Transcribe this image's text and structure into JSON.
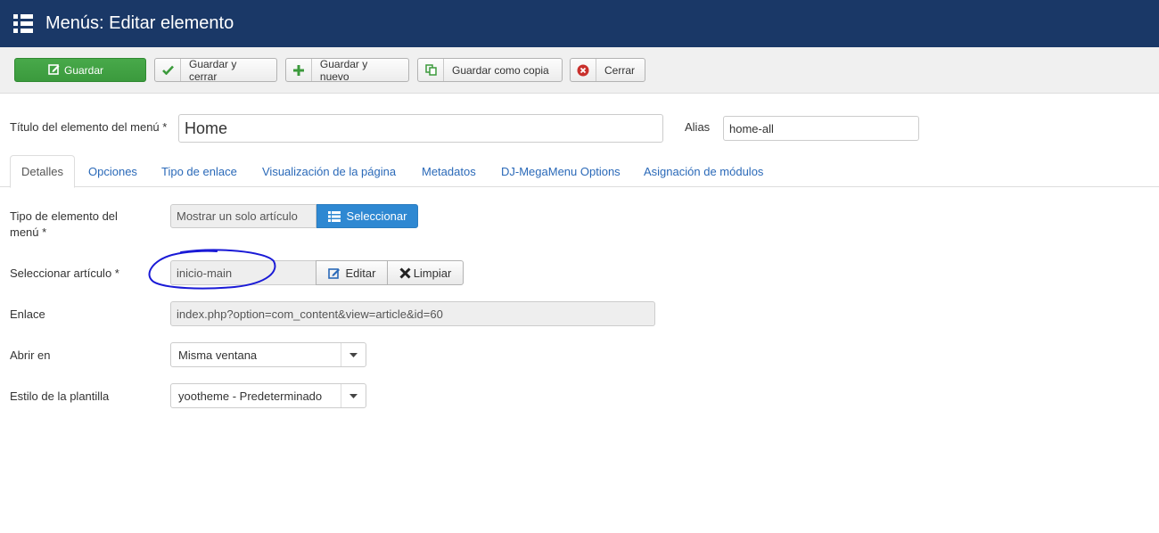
{
  "header": {
    "title": "Menús: Editar elemento",
    "icon": "list-icon"
  },
  "toolbar": {
    "save": "Guardar",
    "save_close": "Guardar y cerrar",
    "save_new": "Guardar y nuevo",
    "save_copy": "Guardar como copia",
    "close": "Cerrar"
  },
  "form": {
    "title_label": "Título del elemento del menú *",
    "title_value": "Home",
    "alias_label": "Alias",
    "alias_value": "home-all"
  },
  "tabs": [
    {
      "label": "Detalles",
      "active": true
    },
    {
      "label": "Opciones"
    },
    {
      "label": "Tipo de enlace"
    },
    {
      "label": "Visualización de la página"
    },
    {
      "label": "Metadatos"
    },
    {
      "label": "DJ-MegaMenu Options"
    },
    {
      "label": "Asignación de módulos"
    }
  ],
  "details": {
    "type_label_1": "Tipo de elemento del",
    "type_label_2": "menú *",
    "type_value": "Mostrar un solo artículo",
    "select_button": "Seleccionar",
    "article_label": "Seleccionar artículo *",
    "article_value": "inicio-main",
    "edit_button": "Editar",
    "clear_button": "Limpiar",
    "link_label": "Enlace",
    "link_value": "index.php?option=com_content&view=article&id=60",
    "open_label": "Abrir en",
    "open_value": "Misma ventana",
    "style_label": "Estilo de la plantilla",
    "style_value": "yootheme - Predeterminado"
  },
  "colors": {
    "header_bg": "#1a3867",
    "save_green": "#46a546",
    "select_blue": "#2e88d2",
    "annotation": "#1a1ad6"
  }
}
